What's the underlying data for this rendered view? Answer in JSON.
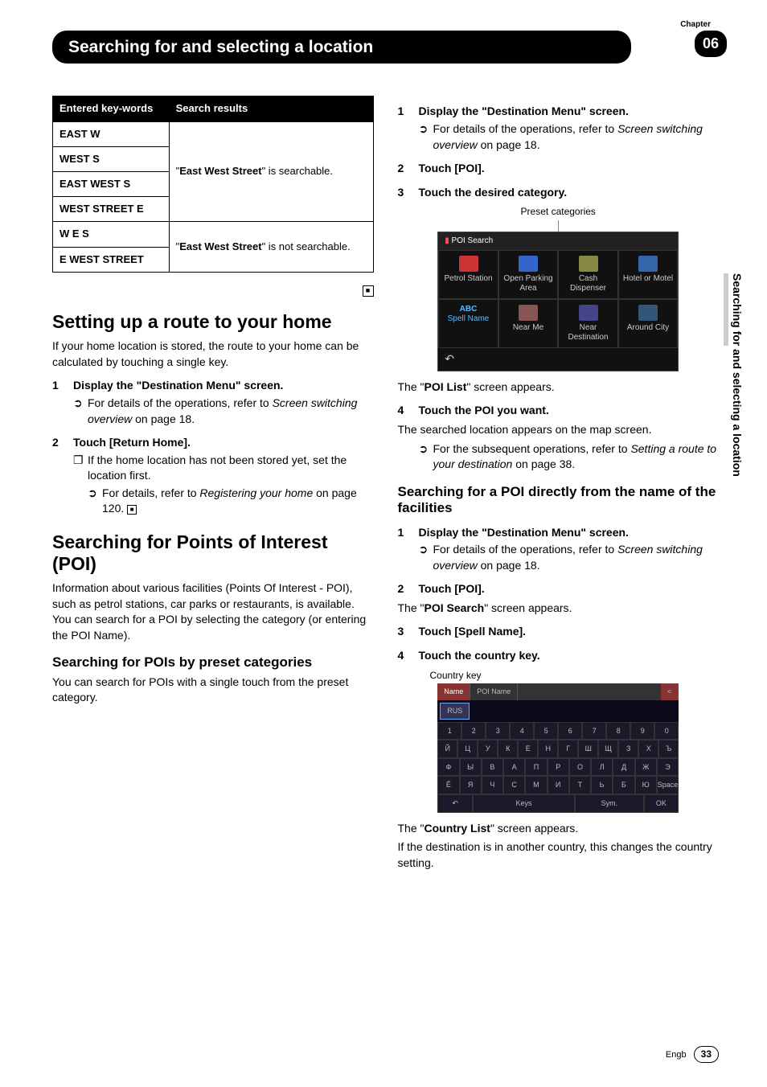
{
  "chapter": {
    "label": "Chapter",
    "number": "06"
  },
  "title": "Searching for and selecting a location",
  "side_title": "Searching for and selecting a location",
  "footer": {
    "lang": "Engb",
    "page": "33"
  },
  "table": {
    "head1": "Entered key-words",
    "head2": "Search results",
    "rows_group1": [
      "EAST W",
      "WEST S",
      "EAST WEST S",
      "WEST STREET E"
    ],
    "result1_pre": "\"",
    "result1_bold": "East West Street",
    "result1_post": "\" is searchable.",
    "rows_group2": [
      "W E S",
      "E WEST STREET"
    ],
    "result2_pre": "\"",
    "result2_bold": "East West Street",
    "result2_post": "\" is not searchable."
  },
  "home": {
    "heading": "Setting up a route to your home",
    "intro": "If your home location is stored, the route to your home can be calculated by touching a single key.",
    "step1": "Display the \"Destination Menu\" screen.",
    "step1_ref_pre": "For details of the operations, refer to ",
    "step1_ref_italic": "Screen switching overview",
    "step1_ref_post": " on page 18.",
    "step2": "Touch [Return Home].",
    "step2_note": "If the home location has not been stored yet, set the location first.",
    "step2_ref_pre": "For details, refer to ",
    "step2_ref_italic": "Registering your home",
    "step2_ref_post": " on page 120."
  },
  "poi": {
    "heading": "Searching for Points of Interest (POI)",
    "intro": "Information about various facilities (Points Of Interest - POI), such as petrol stations, car parks or restaurants, is available. You can search for a POI by selecting the category (or entering the POI Name).",
    "preset_heading": "Searching for POIs by preset categories",
    "preset_intro": "You can search for POIs with a single touch from the preset category."
  },
  "right": {
    "step1": "Display the \"Destination Menu\" screen.",
    "ref_pre": "For details of the operations, refer to ",
    "ref_italic": "Screen switching overview",
    "ref_post": " on page 18.",
    "step2": "Touch [POI].",
    "step3": "Touch the desired category.",
    "caption1": "Preset categories",
    "ss": {
      "header": "POI Search",
      "c1": "Petrol Station",
      "c2": "Open Parking Area",
      "c3": "Cash Dispenser",
      "c4": "Hotel or Motel",
      "c5": "Spell Name",
      "c5_abc": "ABC",
      "c6": "Near Me",
      "c7": "Near Destination",
      "c8": "Around City",
      "back": "↶"
    },
    "after_ss_pre": "The \"",
    "after_ss_bold": "POI List",
    "after_ss_post": "\" screen appears.",
    "step4": "Touch the POI you want.",
    "step4_body": "The searched location appears on the map screen.",
    "step4_ref_pre": "For the subsequent operations, refer to ",
    "step4_ref_italic": "Setting a route to your destination",
    "step4_ref_post": " on page 38.",
    "name_heading": "Searching for a POI directly from the name of the facilities",
    "n_step1": "Display the \"Destination Menu\" screen.",
    "n_step2": "Touch [POI].",
    "n_step2_after_pre": "The \"",
    "n_step2_after_bold": "POI Search",
    "n_step2_after_post": "\" screen appears.",
    "n_step3": "Touch [Spell Name].",
    "n_step4": "Touch the country key.",
    "caption2": "Country key",
    "kbd": {
      "tab1": "Name",
      "tab2": "POI Name",
      "del": "<",
      "country": "RUS",
      "row1": [
        "1",
        "2",
        "3",
        "4",
        "5",
        "6",
        "7",
        "8",
        "9",
        "0"
      ],
      "row2": [
        "Й",
        "Ц",
        "У",
        "К",
        "Е",
        "Н",
        "Г",
        "Ш",
        "Щ",
        "З",
        "Х",
        "Ъ"
      ],
      "row3": [
        "Ф",
        "Ы",
        "В",
        "А",
        "П",
        "Р",
        "О",
        "Л",
        "Д",
        "Ж",
        "Э"
      ],
      "row4": [
        "Ё",
        "Я",
        "Ч",
        "С",
        "М",
        "И",
        "Т",
        "Ь",
        "Б",
        "Ю",
        "Space"
      ],
      "bottom_back": "↶",
      "bottom_keys": "Keys",
      "bottom_sym": "Sym.",
      "bottom_ok": "OK"
    },
    "after_kbd_pre": "The \"",
    "after_kbd_bold": "Country List",
    "after_kbd_post": "\" screen appears.",
    "after_kbd2": "If the destination is in another country, this changes the country setting."
  }
}
